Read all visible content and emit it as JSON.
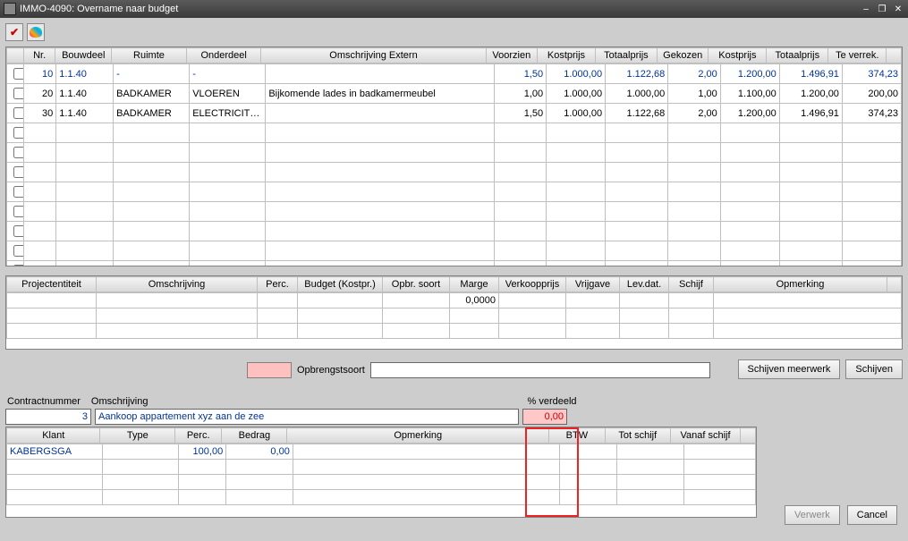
{
  "window": {
    "title": "IMMO-4090: Overname naar budget"
  },
  "grid1": {
    "headers": {
      "nr": "Nr.",
      "bouwdeel": "Bouwdeel",
      "ruimte": "Ruimte",
      "onderdeel": "Onderdeel",
      "omschrijving_extern": "Omschrijving Extern",
      "voorzien": "Voorzien",
      "kostprijs": "Kostprijs",
      "totaalprijs": "Totaalprijs",
      "gekozen": "Gekozen",
      "kostprijs2": "Kostprijs",
      "totaalprijs2": "Totaalprijs",
      "te_verrek": "Te verrek."
    },
    "rows": [
      {
        "nr": "10",
        "bouwdeel": "1.1.40",
        "ruimte": "-",
        "onderdeel": "-",
        "omschrijving": "",
        "voorzien": "1,50",
        "kostprijs": "1.000,00",
        "totaalprijs": "1.122,68",
        "gekozen": "2,00",
        "kostprijs2": "1.200,00",
        "totaalprijs2": "1.496,91",
        "te_verrek": "374,23",
        "blue": true
      },
      {
        "nr": "20",
        "bouwdeel": "1.1.40",
        "ruimte": "BADKAMER",
        "onderdeel": "VLOEREN",
        "omschrijving": "Bijkomende lades in badkamermeubel",
        "voorzien": "1,00",
        "kostprijs": "1.000,00",
        "totaalprijs": "1.000,00",
        "gekozen": "1,00",
        "kostprijs2": "1.100,00",
        "totaalprijs2": "1.200,00",
        "te_verrek": "200,00",
        "blue": false
      },
      {
        "nr": "30",
        "bouwdeel": "1.1.40",
        "ruimte": "BADKAMER",
        "onderdeel": "ELECTRICITEIT",
        "omschrijving": "",
        "voorzien": "1,50",
        "kostprijs": "1.000,00",
        "totaalprijs": "1.122,68",
        "gekozen": "2,00",
        "kostprijs2": "1.200,00",
        "totaalprijs2": "1.496,91",
        "te_verrek": "374,23",
        "blue": false
      }
    ]
  },
  "grid2": {
    "headers": {
      "projectentiteit": "Projectentiteit",
      "omschrijving": "Omschrijving",
      "perc": "Perc.",
      "budget": "Budget (Kostpr.)",
      "opbr_soort": "Opbr. soort",
      "marge": "Marge",
      "verkoopprijs": "Verkoopprijs",
      "vrijgave": "Vrijgave",
      "lev_dat": "Lev.dat.",
      "schijf": "Schijf",
      "opmerking": "Opmerking"
    },
    "rows": [
      {
        "marge": "0,0000"
      }
    ]
  },
  "opbrengst": {
    "label": "Opbrengstsoort"
  },
  "buttons": {
    "schijven_meerwerk": "Schijven meerwerk",
    "schijven": "Schijven",
    "verwerk": "Verwerk",
    "cancel": "Cancel"
  },
  "contract": {
    "contractnummer_label": "Contractnummer",
    "contractnummer_value": "3",
    "omschrijving_label": "Omschrijving",
    "omschrijving_value": "Aankoop appartement xyz aan de zee",
    "pct_verdeeld_label": "% verdeeld",
    "pct_verdeeld_value": "0,00"
  },
  "grid3": {
    "headers": {
      "klant": "Klant",
      "type": "Type",
      "perc": "Perc.",
      "bedrag": "Bedrag",
      "opmerking": "Opmerking",
      "btw": "BTW",
      "tot_schijf": "Tot schijf",
      "vanaf_schijf": "Vanaf schijf"
    },
    "rows": [
      {
        "klant": "KABERGSGA",
        "type": "",
        "perc": "100,00",
        "bedrag": "0,00",
        "opmerking": "",
        "btw": "",
        "tot_schijf": "",
        "vanaf_schijf": ""
      }
    ]
  }
}
